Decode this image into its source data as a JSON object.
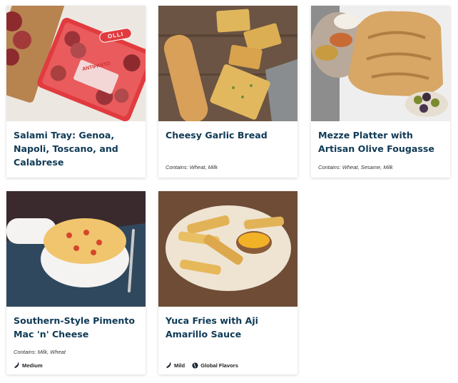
{
  "products": [
    {
      "title": "Salami Tray: Genoa, Napoli, Toscano, and Calabrese",
      "contains": "",
      "image": "salami-tray-photo",
      "tags": [],
      "package": {
        "brand": "OLLI",
        "label": "ANTIPASTO"
      }
    },
    {
      "title": "Cheesy Garlic Bread",
      "contains": "Contains: Wheat, Milk",
      "image": "cheesy-garlic-bread-photo",
      "tags": []
    },
    {
      "title": "Mezze Platter with Artisan Olive Fougasse",
      "contains": "Contains: Wheat, Sesame, Milk",
      "image": "mezze-platter-photo",
      "tags": []
    },
    {
      "title": "Southern-Style Pimento Mac 'n' Cheese",
      "contains": "Contains: Milk, Wheat",
      "image": "pimento-mac-cheese-photo",
      "tags": [
        {
          "label": "Medium",
          "icon": "pepper-icon"
        }
      ]
    },
    {
      "title": "Yuca Fries with Aji Amarillo Sauce",
      "contains": "",
      "image": "yuca-fries-photo",
      "tags": [
        {
          "label": "Mild",
          "icon": "pepper-icon"
        },
        {
          "label": "Global Flavors",
          "icon": "globe-icon"
        }
      ]
    }
  ],
  "colors": {
    "title": "#0f3a56",
    "text": "#222222",
    "card_bg": "#ffffff"
  }
}
